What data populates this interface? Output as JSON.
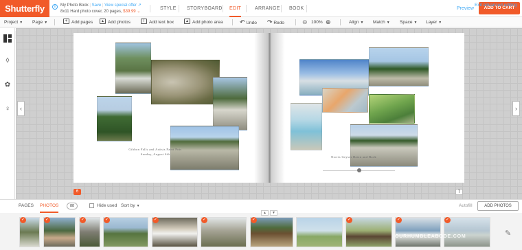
{
  "header": {
    "logo": "Shutterfly",
    "project_title": "My Photo Book",
    "save_link": "Save",
    "special_offer_link": "View special offer",
    "book_specs": "8x11 Hard photo cover, 20 pages,",
    "price": "$39.99",
    "mode_tabs": [
      "STYLE",
      "STORYBOARD",
      "EDIT",
      "ARRANGE",
      "BOOK"
    ],
    "active_tab": "EDIT",
    "preview": "Preview",
    "add_to_cart": "ADD TO CART"
  },
  "toolbar": {
    "project": "Project",
    "page": "Page",
    "add_pages": "Add pages",
    "add_photos": "Add photos",
    "add_text_box": "Add text box",
    "add_photo_area": "Add photo area",
    "undo": "Undo",
    "redo": "Redo",
    "zoom": "100%",
    "align": "Align",
    "match": "Match",
    "space": "Space",
    "layer": "Layer",
    "exit_advanced": "Exit advanced editing"
  },
  "spread": {
    "left_caption_line1": "Gibbon Falls and Artists Paint Pots",
    "left_caption_line2": "Sunday, August 6th",
    "right_caption": "Norris Geyser Basin and Back",
    "left_page_number": "6",
    "right_page_number": "7"
  },
  "bottom_panel": {
    "tab_pages": "PAGES",
    "tab_photos": "PHOTOS",
    "photo_count": "88",
    "hide_used": "Hide used",
    "sort_by": "Sort by",
    "autofill": "Autofill",
    "add_photos_button": "ADD PHOTOS",
    "watermark": "OURHUMBLEABODE.COM"
  },
  "colors": {
    "brand_orange": "#f15a29",
    "link_blue": "#3fa9f5"
  }
}
